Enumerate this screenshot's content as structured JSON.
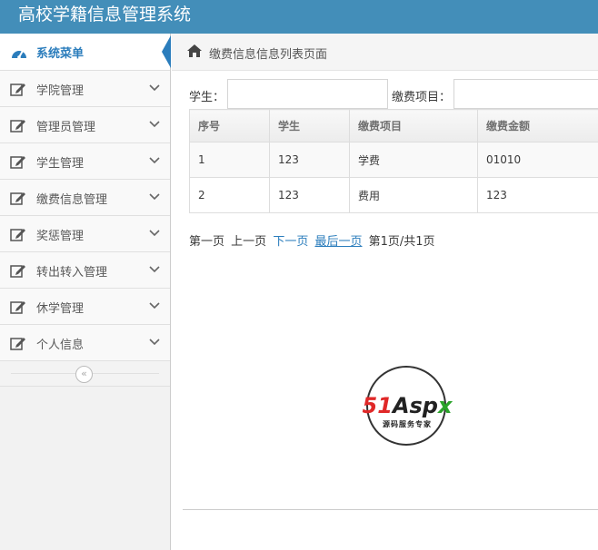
{
  "app": {
    "title": "高校学籍信息管理系统"
  },
  "sidebar": {
    "header": {
      "label": "系统菜单",
      "icon": "dashboard-icon"
    },
    "items": [
      {
        "label": "学院管理",
        "icon": "edit-icon"
      },
      {
        "label": "管理员管理",
        "icon": "edit-icon"
      },
      {
        "label": "学生管理",
        "icon": "edit-icon"
      },
      {
        "label": "缴费信息管理",
        "icon": "edit-icon"
      },
      {
        "label": "奖惩管理",
        "icon": "edit-icon"
      },
      {
        "label": "转出转入管理",
        "icon": "edit-icon"
      },
      {
        "label": "休学管理",
        "icon": "edit-icon"
      },
      {
        "label": "个人信息",
        "icon": "edit-icon"
      }
    ],
    "collapse_glyph": "«"
  },
  "breadcrumb": {
    "text": "缴费信息信息列表页面",
    "icon": "home-icon"
  },
  "search": {
    "student_label": "学生：",
    "student_value": "",
    "item_label": "缴费项目：",
    "item_value": ""
  },
  "table": {
    "headers": [
      "序号",
      "学生",
      "缴费项目",
      "缴费金额"
    ],
    "rows": [
      [
        "1",
        "123",
        "学费",
        "01010"
      ],
      [
        "2",
        "123",
        "费用",
        "123"
      ]
    ]
  },
  "pager": {
    "first": "第一页",
    "prev": "上一页",
    "next": "下一页",
    "last": "最后一页",
    "info": "第1页/共1页"
  },
  "watermark": {
    "brand_red": "51",
    "brand_dark": "Asp",
    "brand_green": "x",
    "subtitle": "源码服务专家"
  },
  "colors": {
    "topbar": "#438eb9",
    "accent": "#2b7dbc"
  }
}
